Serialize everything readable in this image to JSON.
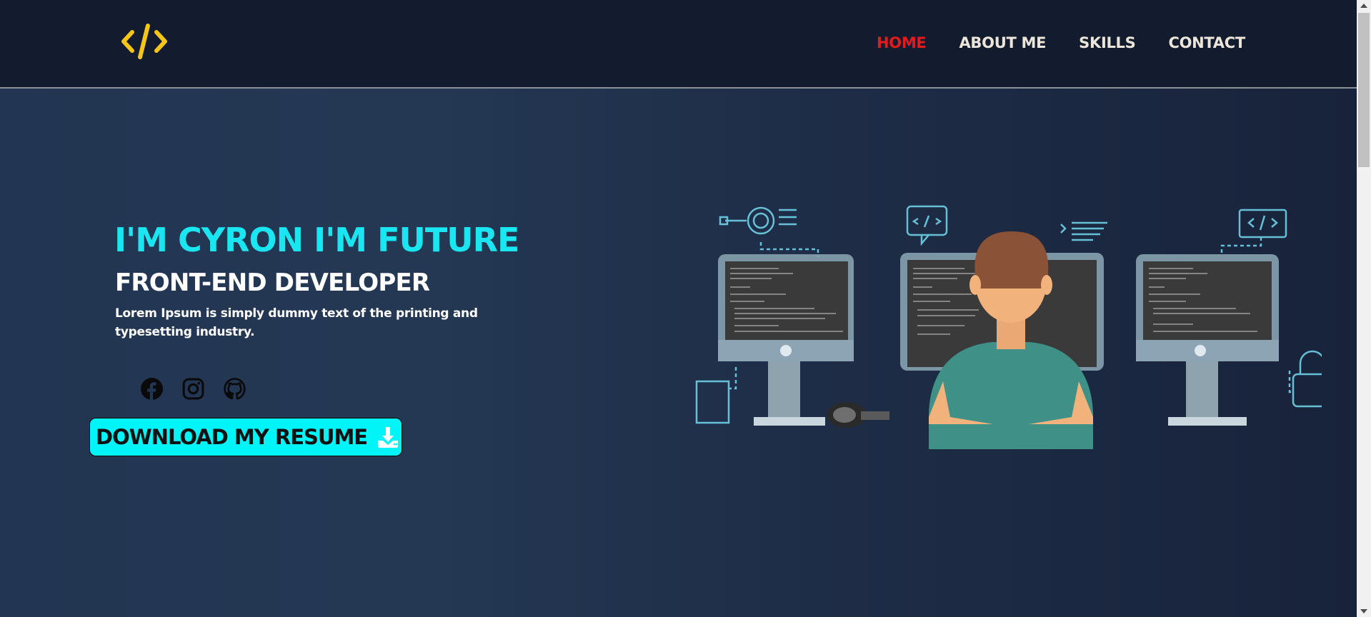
{
  "header": {
    "logo_icon": "code-brackets-icon",
    "nav": [
      {
        "label": "HOME",
        "active": true
      },
      {
        "label": "ABOUT ME",
        "active": false
      },
      {
        "label": "SKILLS",
        "active": false
      },
      {
        "label": "CONTACT",
        "active": false
      }
    ]
  },
  "hero": {
    "title": "I'M CYRON I'M FUTURE",
    "subtitle": "FRONT-END DEVELOPER",
    "description": "Lorem Ipsum is simply dummy text of the printing and typesetting industry.",
    "socials": [
      {
        "icon": "facebook-icon"
      },
      {
        "icon": "instagram-icon"
      },
      {
        "icon": "github-icon"
      }
    ],
    "resume_button": {
      "label": "DOWNLOAD MY RESUME",
      "icon": "download-icon"
    },
    "illustration": "developer-at-monitors-illustration"
  },
  "colors": {
    "header_bg": "#131b2e",
    "accent_cyan": "#19e6f0",
    "nav_active": "#e31b1b",
    "nav_text": "#ece6da",
    "logo": "#f5c518",
    "button_bg": "#00f4f8"
  }
}
